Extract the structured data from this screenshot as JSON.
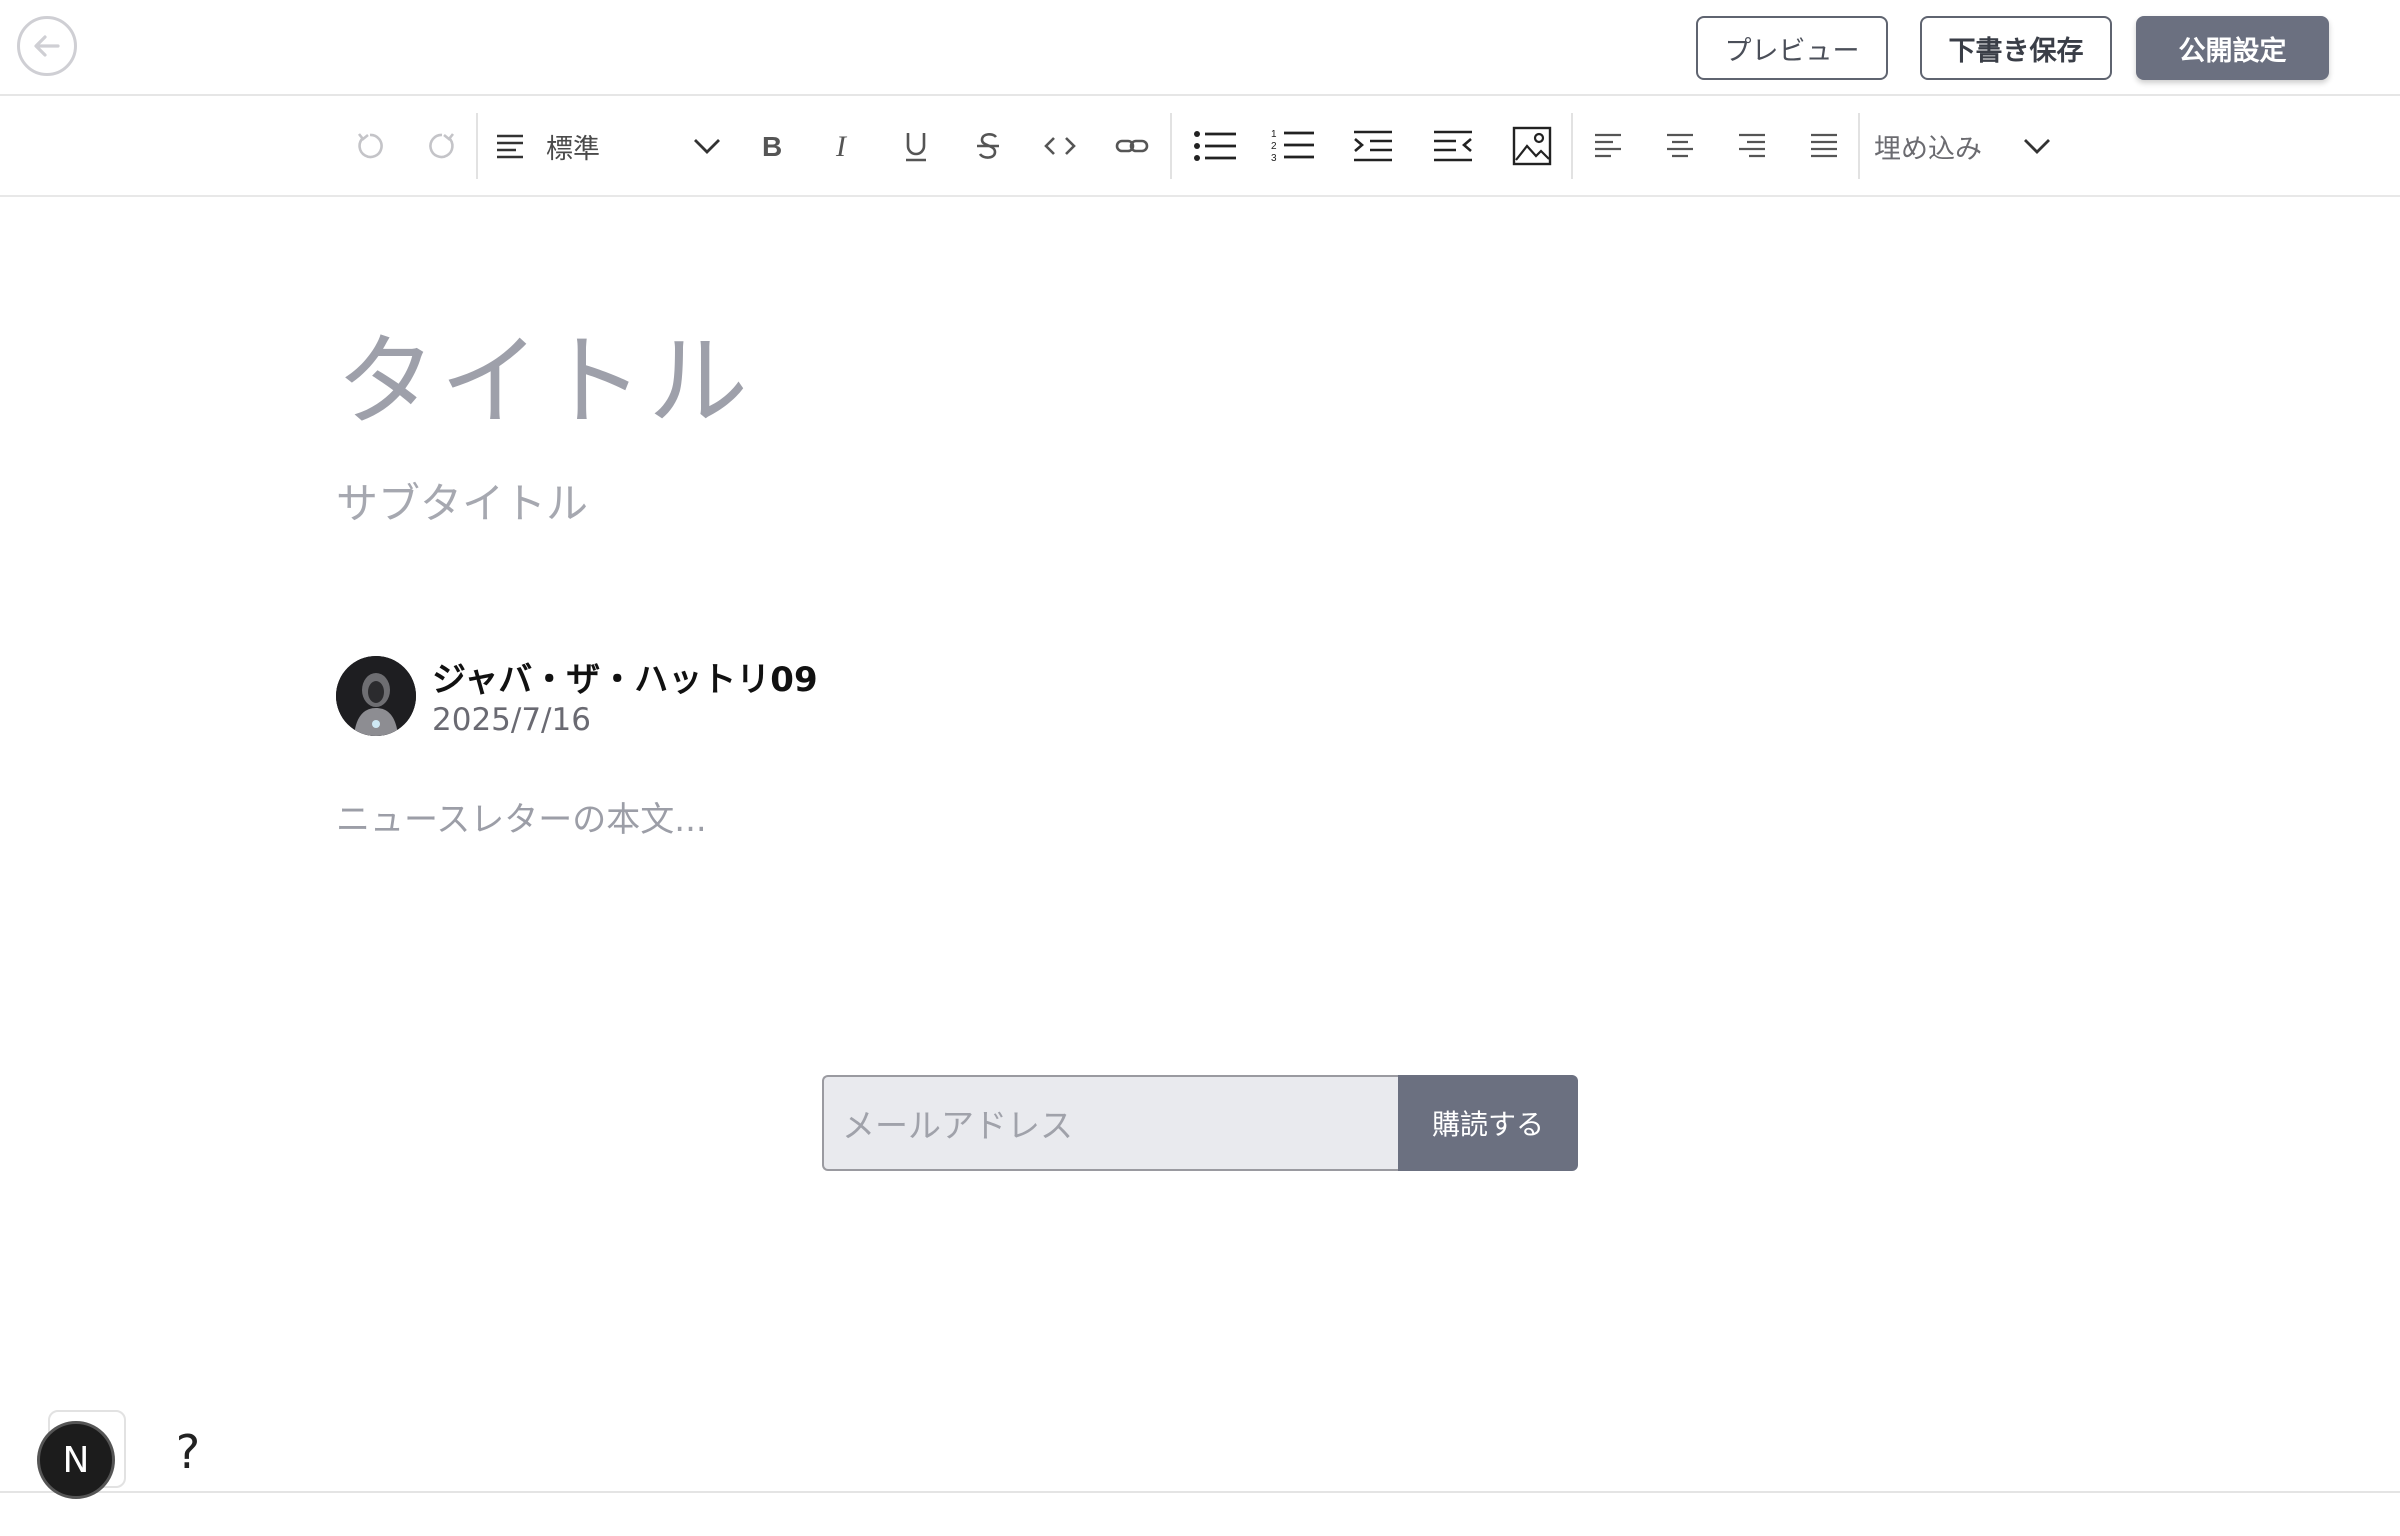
{
  "header": {
    "back_icon": "arrow-left-icon",
    "preview_label": "プレビュー",
    "draft_label": "下書き保存",
    "publish_label": "公開設定"
  },
  "toolbar": {
    "style_value": "標準",
    "embed_label": "埋め込み",
    "icons": [
      "undo-icon",
      "redo-icon",
      "paragraph-style-icon",
      "bold-icon",
      "italic-icon",
      "underline-icon",
      "strikethrough-icon",
      "code-icon",
      "link-icon",
      "bullet-list-icon",
      "numbered-list-icon",
      "indent-icon",
      "outdent-icon",
      "image-icon",
      "align-left-icon",
      "align-center-icon",
      "align-right-icon",
      "align-justify-icon"
    ]
  },
  "editor": {
    "title_placeholder": "タイトル",
    "subtitle_placeholder": "サブタイトル",
    "author_name": "ジャバ・ザ・ハットリ09",
    "date": "2025/7/16",
    "body_placeholder": "ニュースレターの本文..."
  },
  "subscribe": {
    "email_placeholder": "メールアドレス",
    "button_label": "購読する"
  },
  "footer": {
    "badge_letter": "N",
    "help_label": "?"
  },
  "colors": {
    "accent": "#6b7080",
    "placeholder": "#9ea0aa"
  }
}
